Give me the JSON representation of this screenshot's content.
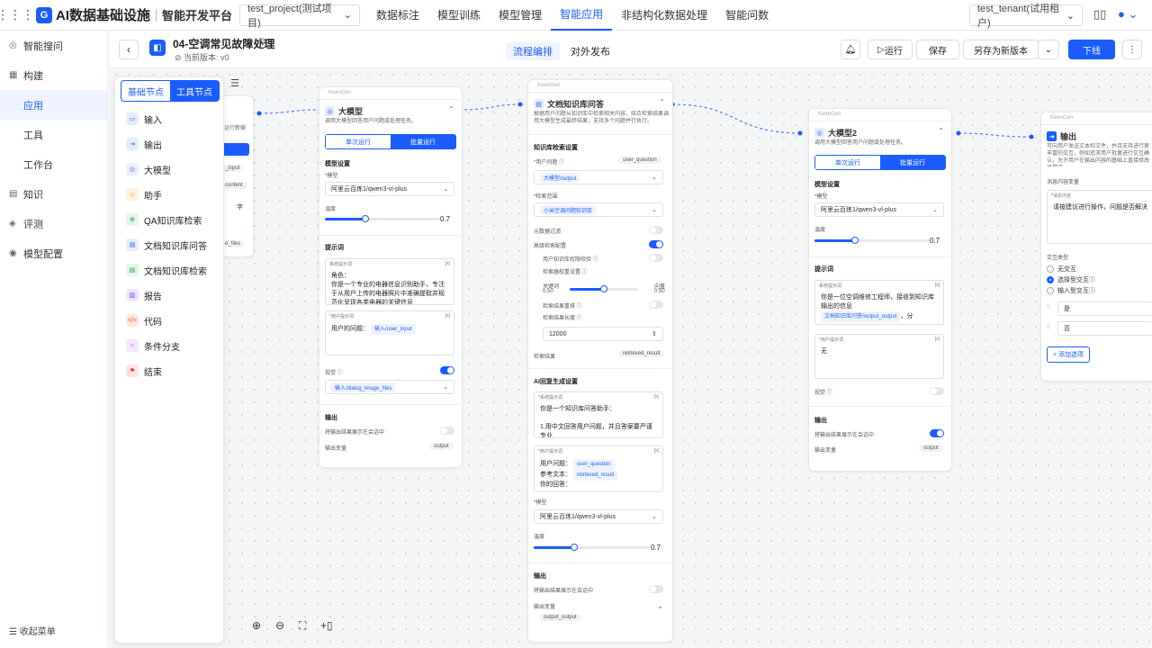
{
  "topbar": {
    "logo_text": "AI数据基础设施",
    "platform": "智能开发平台",
    "project": "test_project(测试项目)",
    "nav": [
      "数据标注",
      "模型训练",
      "模型管理",
      "智能应用",
      "非结构化数据处理",
      "智能问数"
    ],
    "active_nav": "智能应用",
    "tenant": "test_tenant(试用租户)"
  },
  "sidebar": {
    "items": [
      {
        "label": "智能搜问"
      },
      {
        "label": "构建"
      },
      {
        "label": "应用"
      },
      {
        "label": "工具"
      },
      {
        "label": "工作台"
      },
      {
        "label": "知识"
      },
      {
        "label": "评测"
      },
      {
        "label": "模型配置"
      }
    ],
    "collapse": "收起菜单"
  },
  "subbar": {
    "title": "04-空调常见故障处理",
    "version": "当前版本: v0",
    "tabs": [
      "流程编排",
      "对外发布"
    ],
    "run": "运行",
    "save": "保存",
    "save_as": "另存为新版本",
    "publish": "下线"
  },
  "palette": {
    "tab_basic": "基础节点",
    "tab_tool": "工具节点",
    "items": [
      "输入",
      "输出",
      "大模型",
      "助手",
      "QA知识库检索",
      "文档知识库问答",
      "文档知识库检索",
      "报告",
      "代码",
      "条件分支",
      "结束"
    ]
  },
  "partial_node": {
    "frag1": "运行新输",
    "frag2": "_input",
    "frag3": "content",
    "frag4": "字",
    "frag5": "e_files"
  },
  "llm1": {
    "brand": "KeenGen",
    "title": "大模型",
    "desc": "调用大模型回答用户问题或处理任务。",
    "seg_single": "单次运行",
    "seg_batch": "批量运行",
    "model_settings": "模型设置",
    "model_label": "*模型",
    "model": "阿里云百炼1/qwen3-vl-plus",
    "temp_label": "温度",
    "temp": "0.7",
    "temp_value": 0.7,
    "prompt_title": "提示词",
    "sys_label": "系统提示词",
    "sys_text": "角色：\n你是一个专业的电器信息识别助手，专注于从用户上传的电器照片中准确提取并规范化呈现各类电器的关键信息",
    "user_label": "*用户提示词",
    "user_prefix": "用户的问题：",
    "user_var": "输入/user_input",
    "vision_label": "视觉",
    "vision_var": "输入/dialog_image_files",
    "output_title": "输出",
    "output_toggle": "将输出结果展示在会话中",
    "output_var_label": "输出变量",
    "output_var": "output"
  },
  "doc": {
    "brand": "KeenGen",
    "title": "文档知识库问答",
    "desc": "根据用户问题从知识库中检索相关内容，结合检索结果调用大模型生成最终结果，支持多个问题并行执行。",
    "kb_title": "知识库检索设置",
    "q_label": "*用户问题",
    "q_var": "user_question",
    "q_tag": "大模型/output",
    "scope_label": "*检索范围",
    "scope_tag": "小米空调问题知识库",
    "meta": "元数据过滤",
    "advanced": "高级检索配置",
    "perm": "用户知识库权限校验",
    "weight": "检索器权重设置",
    "kw": "关键词",
    "kw_val": "0.50",
    "vec": "向量",
    "vec_val": "0.50",
    "rerank": "检索结果重排",
    "len_label": "检索结果长度",
    "len": "12000",
    "result_label": "检索结果",
    "result_var": "retrieved_result",
    "ai_title": "AI回复生成设置",
    "sys_label": "*系统提示词",
    "sys_text": "你是一个知识库问答助手：\n\n1.用中文回答用户问题，并且答案要严谨专业",
    "user_label": "*用户提示词",
    "u1": "用户问题：",
    "u1_var": "user_question",
    "u2": "参考文本：",
    "u2_var": "retrieved_result",
    "u3": "你的回答：",
    "model_label": "*模型",
    "model": "阿里云百炼1/qwen3-vl-plus",
    "temp_label": "温度",
    "temp": "0.7",
    "temp_value": 0.7,
    "output_title": "输出",
    "output_toggle": "将输出结果展示在会话中",
    "output_var_label": "输出变量",
    "output_var": "output_output"
  },
  "llm2": {
    "brand": "KeenGen",
    "title": "大模型2",
    "desc": "调用大模型回答用户问题或处理任务。",
    "seg_single": "单次运行",
    "seg_batch": "批量运行",
    "model_settings": "模型设置",
    "model_label": "*模型",
    "model": "阿里云百炼1/qwen3-vl-plus",
    "temp_label": "温度",
    "temp": "0.7",
    "temp_value": 0.7,
    "prompt_title": "提示词",
    "sys_label": "系统提示词",
    "sys_text": "你是一位空调维修工程师，接收到知识库输出的信息",
    "sys_var": "文档知识库问答/output_output",
    "sys_tail": "，分",
    "user_label": "*用户提示词",
    "user_text": "无",
    "vision_label": "视觉",
    "output_title": "输出",
    "output_toggle": "将输出结果展示在会话中",
    "output_var_label": "输出变量",
    "output_var": "output"
  },
  "out": {
    "brand": "KeenGen",
    "title": "输出",
    "desc": "可向用户发送文本和文件，并且支持进行更丰富的交互，例如追求用户批量进行交互确认，允许用户在输出内容的基础上直接修改并提交。",
    "msg_label": "消息内容变量",
    "msg_box_label": "*消息内容",
    "msg_text": "请按建议进行操作，问题是否解决",
    "interact_label": "交互类型",
    "opt1": "无交互",
    "opt2": "选择型交互",
    "opt3": "输入型交互",
    "choice1": "是",
    "choice2": "否",
    "add": "+ 添加选项"
  },
  "colors": {
    "accent": "#1a5cff"
  }
}
